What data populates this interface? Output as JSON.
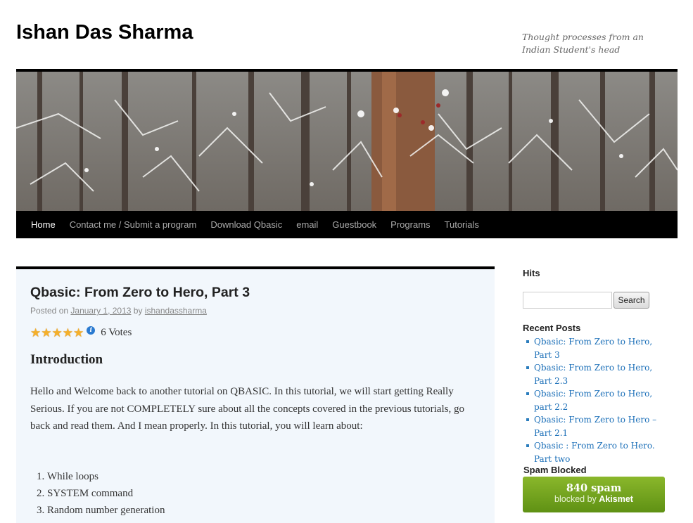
{
  "site": {
    "title": "Ishan Das Sharma",
    "description": "Thought processes from an Indian Student's head"
  },
  "nav": {
    "items": [
      "Home",
      "Contact me / Submit a program",
      "Download Qbasic",
      "email",
      "Guestbook",
      "Programs",
      "Tutorials"
    ],
    "active": "Home"
  },
  "post": {
    "title": "Qbasic: From Zero to Hero, Part 3",
    "meta_posted_on": "Posted on",
    "meta_date": "January 1, 2013",
    "meta_by": "by",
    "meta_author": "ishandassharma",
    "rating_stars": 5,
    "votes": "6 Votes",
    "section_heading": "Introduction",
    "intro": "Hello and Welcome back to another tutorial on QBASIC. In this tutorial, we will start getting Really Serious. If you are not COMPLETELY sure about all the concepts covered in the previous tutorials, go back and read them. And I mean properly. In this tutorial, you will learn about:",
    "topics": [
      "While loops",
      "SYSTEM command",
      "Random number generation"
    ]
  },
  "sidebar": {
    "hits_title": "Hits",
    "search_placeholder": "",
    "search_button": "Search",
    "recent_title": "Recent Posts",
    "recent_posts": [
      "Qbasic: From Zero to Hero, Part 3",
      "Qbasic: From Zero to Hero, Part 2.3",
      "Qbasic: From Zero to Hero, part 2.2",
      "Qbasic: From Zero to Hero – Part 2.1",
      "Qbasic : From Zero to Hero. Part two"
    ],
    "spam_title": "Spam Blocked",
    "spam_count": "840 spam",
    "spam_blocked_by": "blocked by",
    "spam_service": "Akismet"
  },
  "colors": {
    "nav_bg": "#000000",
    "post_bg": "#f2f7fc",
    "link": "#1b6fb8",
    "spam_green": "#6d9f1c",
    "star": "#f5b02a"
  }
}
